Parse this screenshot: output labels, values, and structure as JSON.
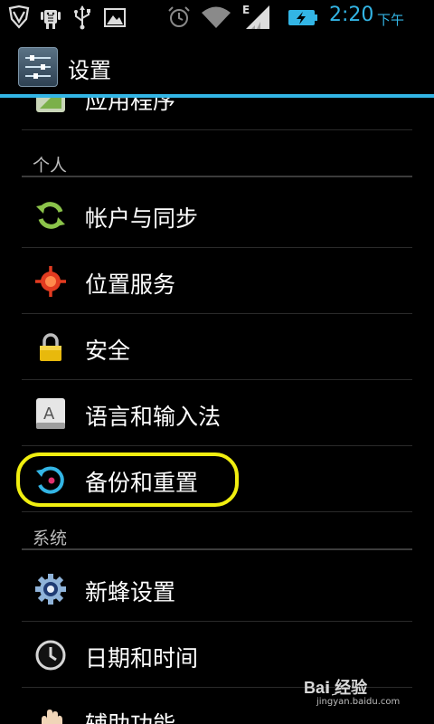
{
  "status_bar": {
    "time": "2:20",
    "ampm": "下午",
    "network_label": "E",
    "accent_color": "#33b5e5",
    "icons": [
      "vpn-shield-icon",
      "android-debug-icon",
      "usb-icon",
      "image-icon",
      "alarm-icon",
      "wifi-icon",
      "signal-icon",
      "battery-charging-icon"
    ]
  },
  "action_bar": {
    "title": "设置",
    "icon": "settings-sliders-icon"
  },
  "list": {
    "partial_item": {
      "label": "应用程序",
      "icon": "apps-icon"
    },
    "personal_header": "个人",
    "personal_items": [
      {
        "label": "帐户与同步",
        "icon": "sync-icon"
      },
      {
        "label": "位置服务",
        "icon": "location-icon"
      },
      {
        "label": "安全",
        "icon": "lock-icon"
      },
      {
        "label": "语言和输入法",
        "icon": "keyboard-icon"
      },
      {
        "label": "备份和重置",
        "icon": "backup-reset-icon",
        "highlighted": true
      }
    ],
    "system_header": "系统",
    "system_items": [
      {
        "label": "新蜂设置",
        "icon": "gear-icon"
      },
      {
        "label": "日期和时间",
        "icon": "clock-icon"
      },
      {
        "label": "辅助功能",
        "icon": "accessibility-hand-icon"
      }
    ]
  },
  "watermark": {
    "brand": "Baiِ 经验",
    "domain": "jingyan.baidu.com"
  }
}
